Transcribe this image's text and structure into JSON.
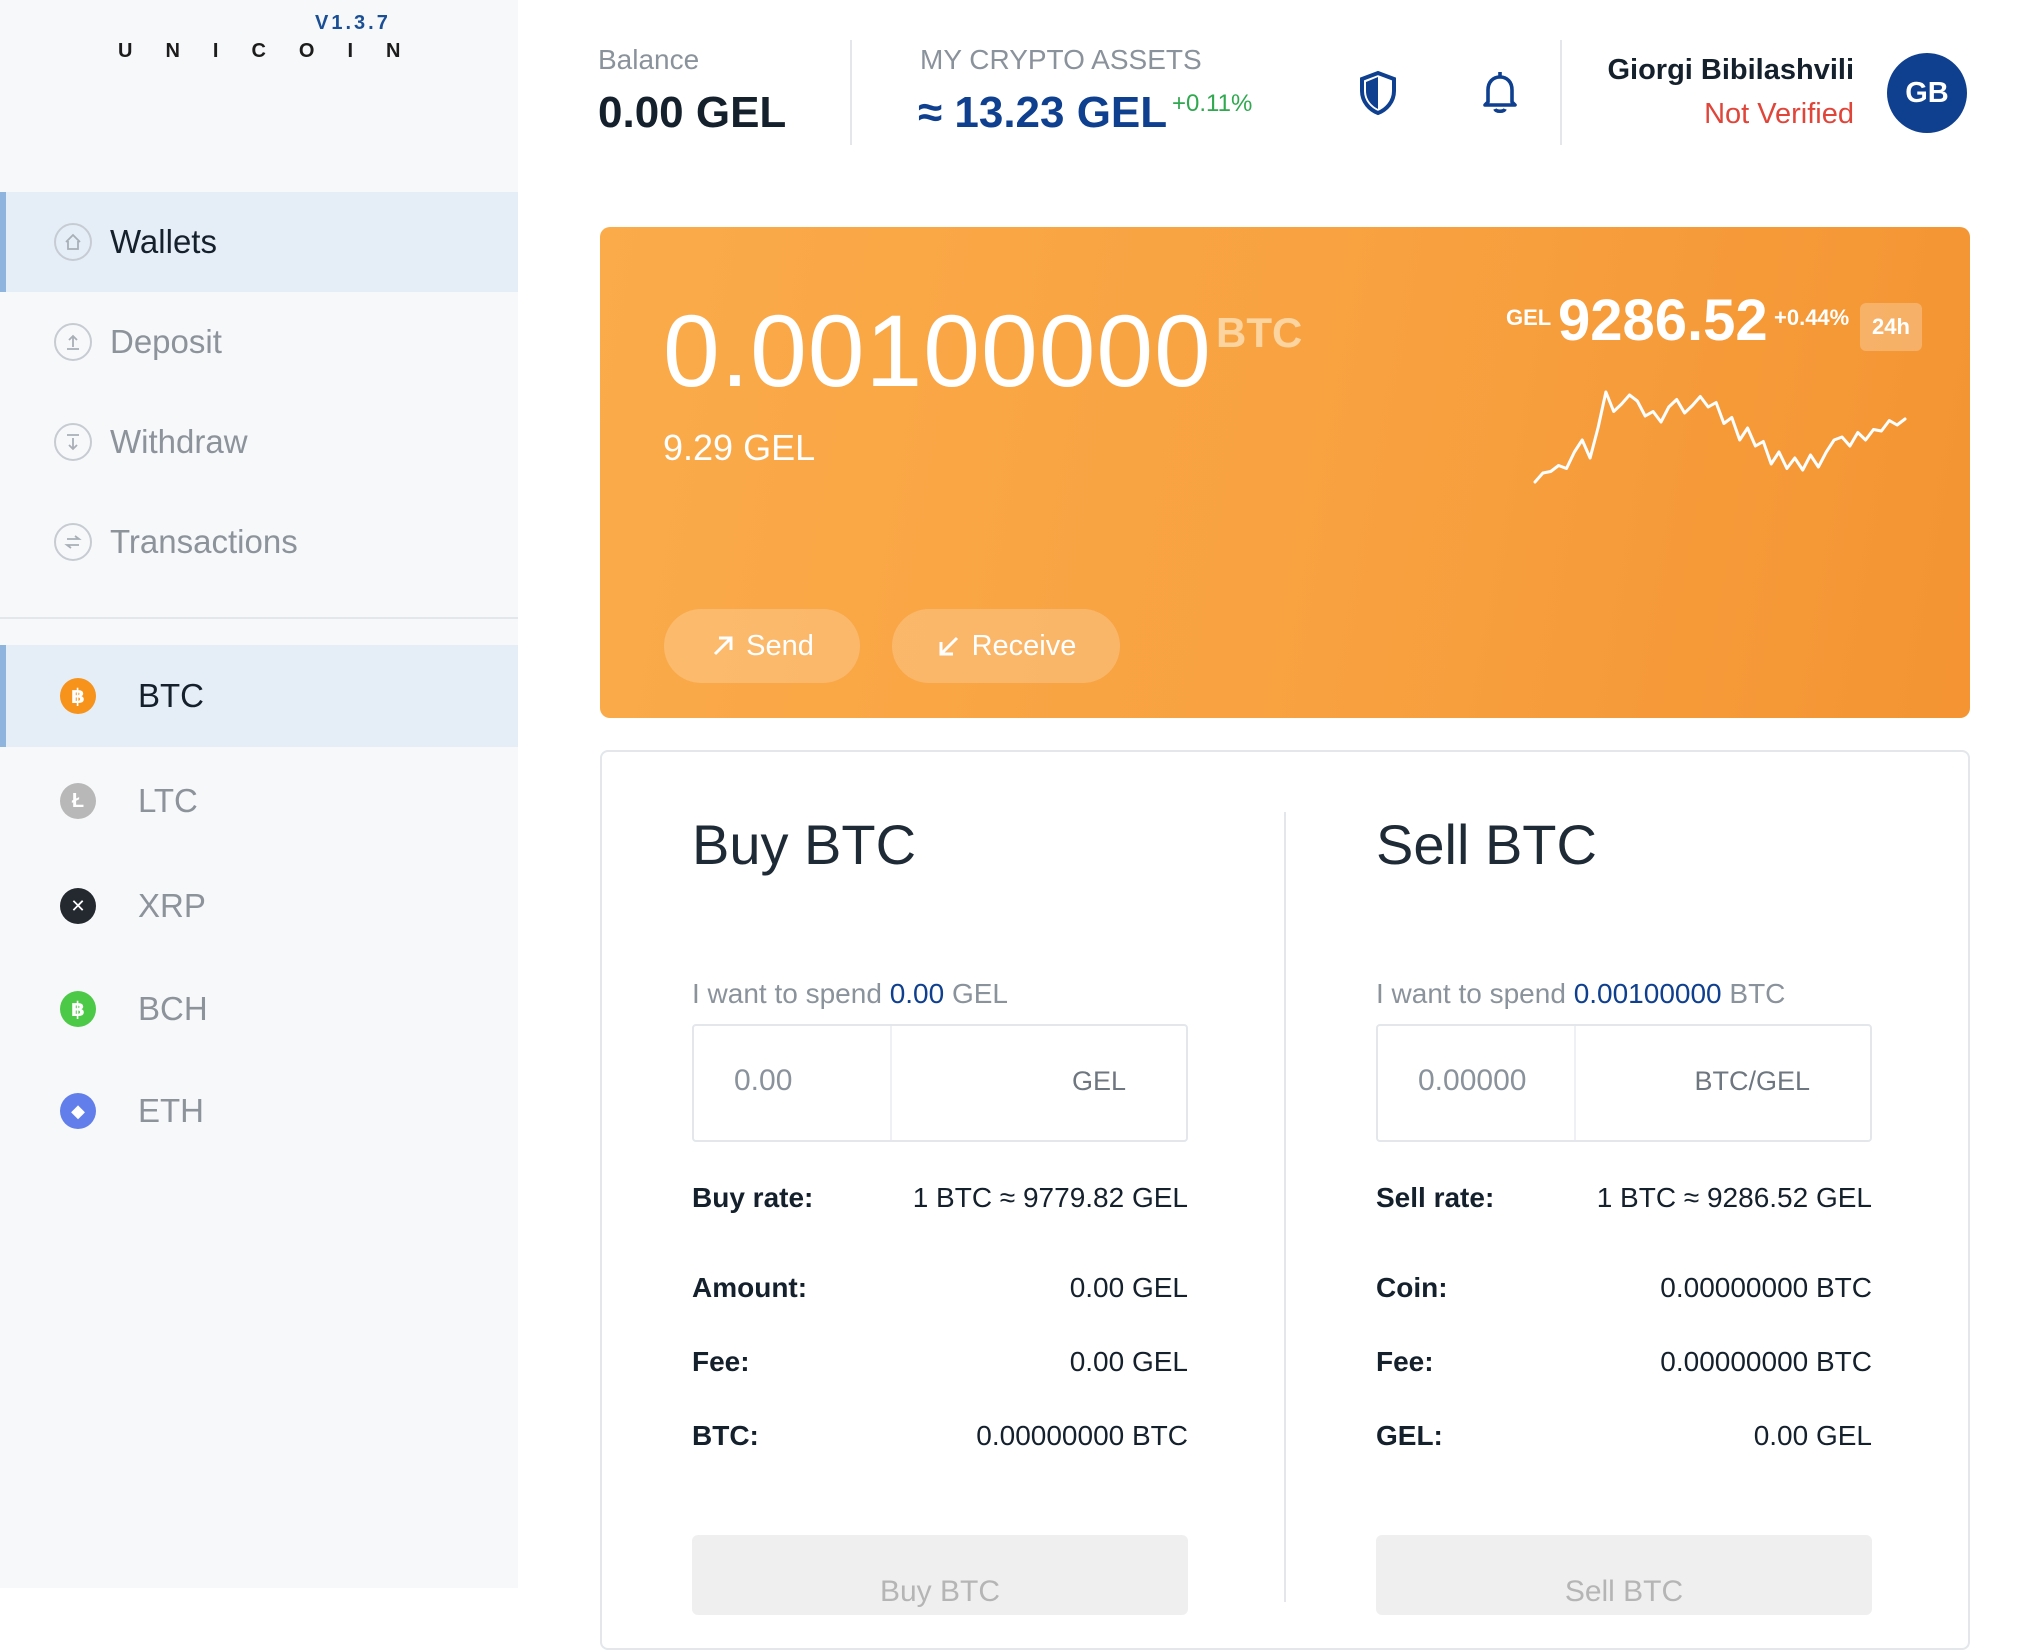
{
  "app": {
    "version": "V1.3.7",
    "logo": "UNICOIN"
  },
  "sidebar": {
    "nav": [
      {
        "label": "Wallets",
        "icon": "home-icon",
        "active": true
      },
      {
        "label": "Deposit",
        "icon": "upload-icon",
        "active": false
      },
      {
        "label": "Withdraw",
        "icon": "download-icon",
        "active": false
      },
      {
        "label": "Transactions",
        "icon": "transfer-icon",
        "active": false
      }
    ],
    "coins": [
      {
        "label": "BTC",
        "color": "#f7931a",
        "glyph": "฿",
        "active": true
      },
      {
        "label": "LTC",
        "color": "#b8b8b8",
        "glyph": "Ł",
        "active": false
      },
      {
        "label": "XRP",
        "color": "#23292f",
        "glyph": "✕",
        "active": false
      },
      {
        "label": "BCH",
        "color": "#4cc947",
        "glyph": "฿",
        "active": false
      },
      {
        "label": "ETH",
        "color": "#627eea",
        "glyph": "◆",
        "active": false
      }
    ]
  },
  "header": {
    "balance_label": "Balance",
    "balance_value": "0.00 GEL",
    "assets_label": "MY CRYPTO ASSETS",
    "assets_value": "≈ 13.23 GEL",
    "assets_change": "+0.11%",
    "user_name": "Giorgi Bibilashvili",
    "user_status": "Not Verified",
    "avatar_initials": "GB"
  },
  "wallet_card": {
    "amount": "0.00100000",
    "unit": "BTC",
    "fiat_value": "9.29 GEL",
    "price_currency": "GEL",
    "price": "9286.52",
    "price_change": "+0.44%",
    "period": "24h",
    "sparkline": [
      2,
      8,
      9,
      13,
      11,
      22,
      30,
      18,
      38,
      62,
      49,
      54,
      60,
      56,
      46,
      49,
      42,
      52,
      57,
      48,
      53,
      59,
      52,
      55,
      41,
      45,
      30,
      38,
      26,
      29,
      14,
      22,
      11,
      18,
      10,
      20,
      12,
      22,
      30,
      32,
      26,
      35,
      30,
      37,
      36,
      43,
      40,
      44
    ],
    "send_label": "Send",
    "receive_label": "Receive"
  },
  "buy": {
    "title": "Buy BTC",
    "spend_prefix": "I want to spend",
    "spend_amount": "0.00",
    "spend_unit": "GEL",
    "input_value": "0.00",
    "input_unit": "GEL",
    "rows": [
      {
        "label": "Buy rate:",
        "value": "1 BTC ≈ 9779.82 GEL"
      },
      {
        "label": "Amount:",
        "value": "0.00 GEL"
      },
      {
        "label": "Fee:",
        "value": "0.00 GEL"
      },
      {
        "label": "BTC:",
        "value": "0.00000000 BTC"
      }
    ],
    "button": "Buy BTC"
  },
  "sell": {
    "title": "Sell BTC",
    "spend_prefix": "I want to spend",
    "spend_amount": "0.00100000",
    "spend_unit": "BTC",
    "input_value": "0.00000",
    "input_unit": "BTC/GEL",
    "rows": [
      {
        "label": "Sell rate:",
        "value": "1 BTC ≈ 9286.52 GEL"
      },
      {
        "label": "Coin:",
        "value": "0.00000000 BTC"
      },
      {
        "label": "Fee:",
        "value": "0.00000000 BTC"
      },
      {
        "label": "GEL:",
        "value": "0.00 GEL"
      }
    ],
    "button": "Sell BTC"
  }
}
